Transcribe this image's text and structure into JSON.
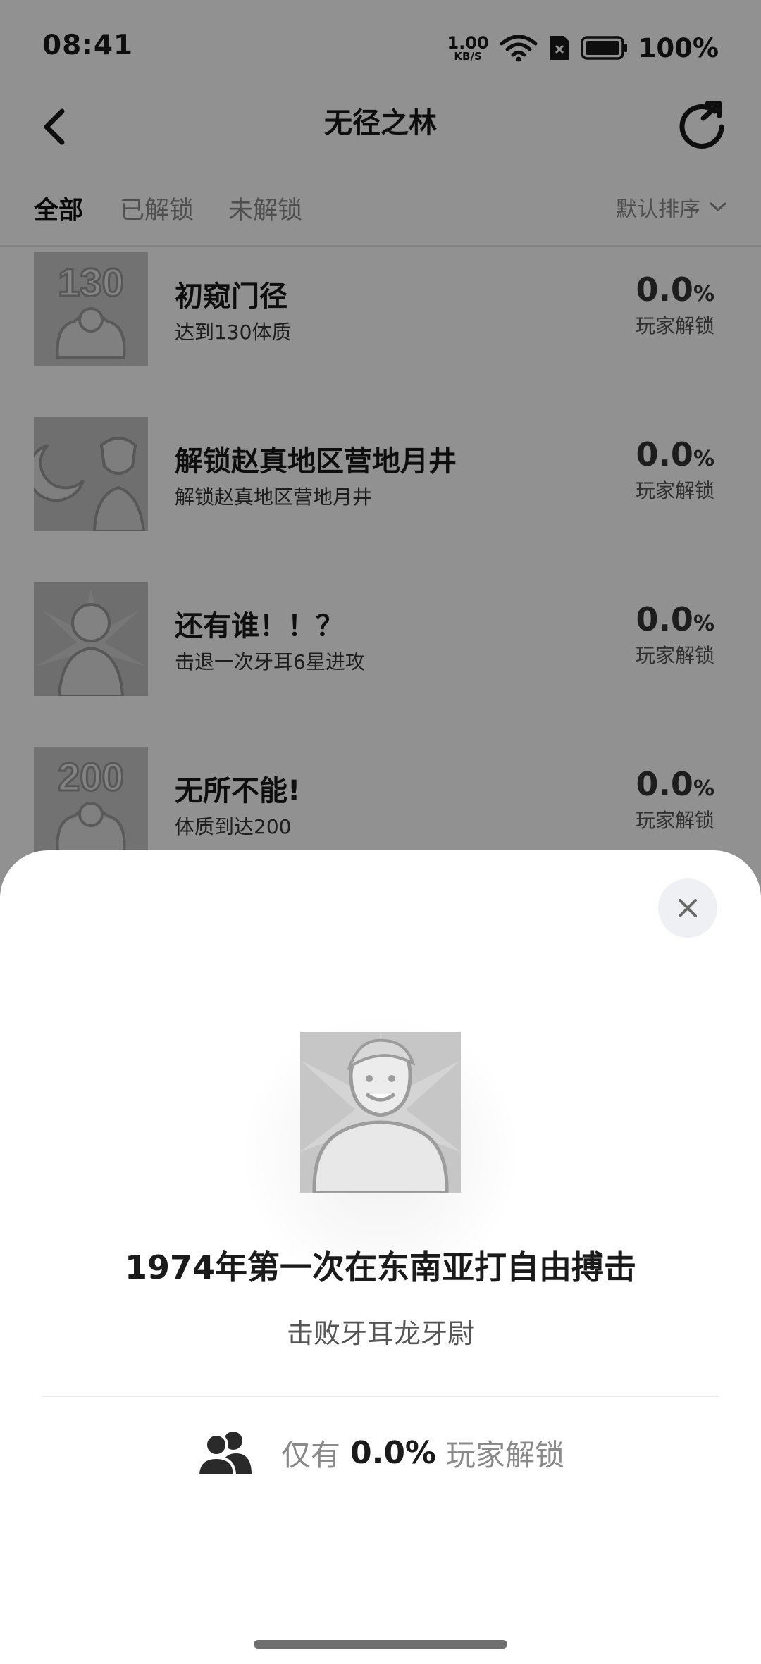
{
  "status_bar": {
    "time": "08:41",
    "net_speed_value": "1.00",
    "net_speed_unit": "KB/S",
    "battery_percent": "100%"
  },
  "nav": {
    "title": "无径之林",
    "back_icon": "chevron-left-icon",
    "share_icon": "share-refresh-icon"
  },
  "tabs": [
    {
      "label": "全部",
      "active": true
    },
    {
      "label": "已解锁",
      "active": false
    },
    {
      "label": "未解锁",
      "active": false
    }
  ],
  "sort": {
    "label": "默认排序",
    "icon": "chevron-down-icon"
  },
  "achievements": [
    {
      "name": "初窥门径",
      "desc": "达到130体质",
      "pct": "0.0",
      "pct_unit": "%",
      "players": "玩家解锁",
      "icon_text": "130"
    },
    {
      "name": "解锁赵真地区营地月井",
      "desc": "解锁赵真地区营地月井",
      "pct": "0.0",
      "pct_unit": "%",
      "players": "玩家解锁",
      "icon_text": ""
    },
    {
      "name": "还有谁！！？",
      "desc": "击退一次牙耳6星进攻",
      "pct": "0.0",
      "pct_unit": "%",
      "players": "玩家解锁",
      "icon_text": ""
    },
    {
      "name": "无所不能!",
      "desc": "体质到达200",
      "pct": "0.0",
      "pct_unit": "%",
      "players": "玩家解锁",
      "icon_text": "200"
    }
  ],
  "sheet": {
    "title": "1974年第一次在东南亚打自由搏击",
    "desc": "击败牙耳龙牙尉",
    "stat_prefix": "仅有",
    "stat_pct": "0.0%",
    "stat_suffix": "玩家解锁",
    "close_icon": "close-icon",
    "users_icon": "users-icon"
  },
  "colors": {
    "overlay": "#000000",
    "sheet_bg": "#ffffff",
    "close_bg": "#eef0f3"
  }
}
